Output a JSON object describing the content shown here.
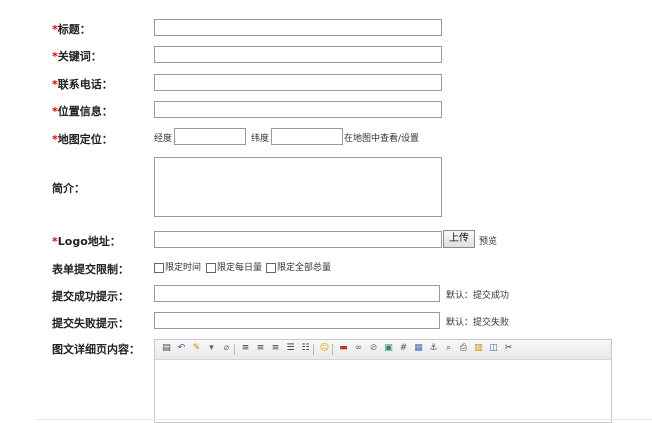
{
  "form": {
    "title": {
      "req": "*",
      "label": "标题："
    },
    "keywords": {
      "req": "*",
      "label": "关键词："
    },
    "phone": {
      "req": "*",
      "label": "联系电话："
    },
    "location": {
      "req": "*",
      "label": "位置信息："
    },
    "map": {
      "req": "*",
      "label": "地图定位：",
      "lng_label": "经度",
      "lat_label": "纬度",
      "map_link": "在地图中查看/设置"
    },
    "intro": {
      "label": "简介："
    },
    "logo": {
      "req": "*",
      "label": "Logo地址：",
      "upload_button": "上传",
      "preview_link": "预览"
    },
    "limit": {
      "label": "表单提交限制：",
      "options": [
        "限定时间",
        "限定每日量",
        "限定全部总量"
      ]
    },
    "success": {
      "label": "提交成功提示：",
      "default_hint": "默认：提交成功"
    },
    "fail": {
      "label": "提交失败提示：",
      "default_hint": "默认：提交失败"
    },
    "detail": {
      "label": "图文详细页内容："
    }
  },
  "toolbar_icons": [
    "source-icon",
    "undo-icon",
    "paint-icon",
    "dropdown-icon",
    "eraser-icon",
    "align-left-icon",
    "align-center-icon",
    "align-right-icon",
    "ordered-list-icon",
    "unordered-list-icon",
    "emoticon-icon",
    "flash-icon",
    "link-icon",
    "unlink-icon",
    "image-icon",
    "table-icon",
    "layout-icon",
    "anchor-icon",
    "preview-icon",
    "print-icon",
    "template-icon",
    "fullscreen-icon",
    "cut-icon"
  ],
  "colors": {
    "required": "#e00000",
    "border": "#9a9a9a"
  }
}
